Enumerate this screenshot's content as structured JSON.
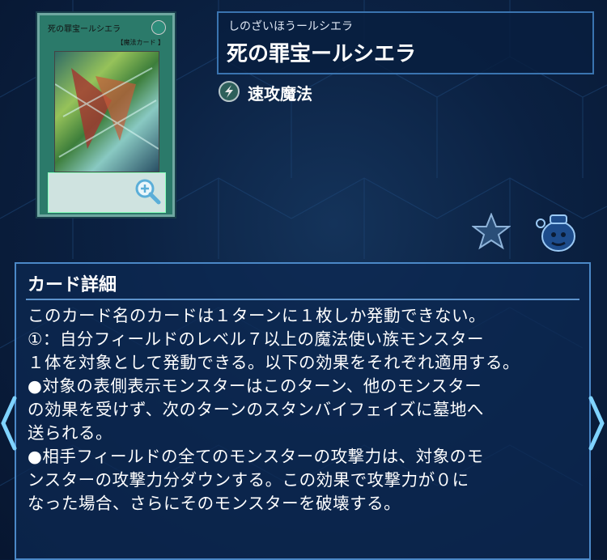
{
  "card": {
    "ruby": "しのざいほうールシエラ",
    "name": "死の罪宝ールシエラ",
    "spell_type": "速攻魔法",
    "art_name": "死の罪宝ールシエラ",
    "art_type": "【魔法カード 】"
  },
  "detail": {
    "heading": "カード詳細",
    "text": "このカード名のカードは１ターンに１枚しか発動できない。\n①：自分フィールドのレベル７以上の魔法使い族モンスター\n１体を対象として発動できる。以下の効果をそれぞれ適用する。\n●対象の表側表示モンスターはこのターン、他のモンスター\nの効果を受けず、次のターンのスタンバイフェイズに墓地へ\n送られる。\n●相手フィールドの全てのモンスターの攻撃力は、対象のモ\nンスターの攻撃力分ダウンする。この効果で攻撃力が０に\nなった場合、さらにそのモンスターを破壊する。"
  },
  "icons": {
    "zoom": "zoom-in-icon",
    "favorite": "star-icon",
    "deck_vase": "vase-icon",
    "spell_quickplay": "quickplay-spell-icon",
    "prev": "chevron-left-icon",
    "next": "chevron-right-icon"
  },
  "colors": {
    "accent": "#4b88c7",
    "background": "#0b2142"
  }
}
